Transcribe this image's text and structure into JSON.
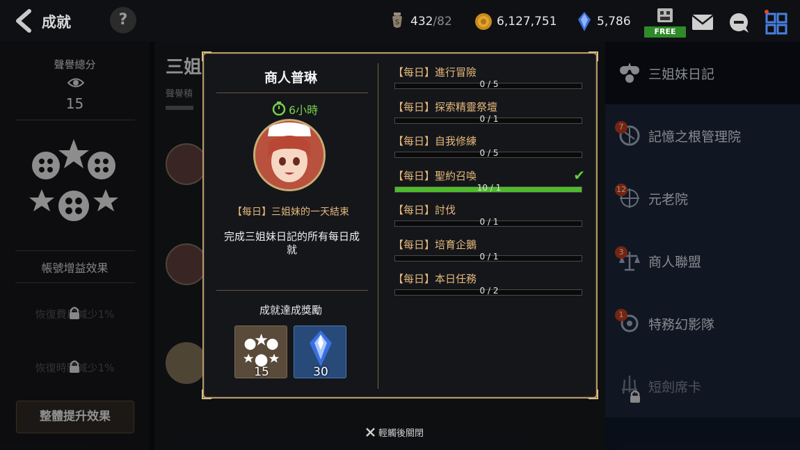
{
  "header": {
    "title": "成就",
    "help_label": "?",
    "stamina": {
      "value": "432",
      "max": "/82"
    },
    "gold": "6,127,751",
    "crystal": "5,786",
    "free_label": "FREE"
  },
  "left_panel": {
    "title": "聲譽總分",
    "score": "15",
    "effect_title": "帳號增益效果",
    "locked_rows": [
      "恢復費用減少1%",
      "恢復時間減少1%"
    ],
    "button_label": "整體提升效果"
  },
  "middle": {
    "title_fragment": "三姐",
    "sub_fragment": "聲譽積"
  },
  "sidebar": {
    "items": [
      {
        "label": "三姐妹日記",
        "badge": ""
      },
      {
        "label": "記憶之根管理院",
        "badge": "7"
      },
      {
        "label": "元老院",
        "badge": "12"
      },
      {
        "label": "商人聯盟",
        "badge": "3"
      },
      {
        "label": "特務幻影隊",
        "badge": "1"
      },
      {
        "label": "短劍席卡",
        "badge": ""
      }
    ]
  },
  "modal": {
    "name": "商人普琳",
    "time": "6小時",
    "quest_title": "【每日】三姐妹的一天結束",
    "description": "完成三姐妹日記的所有每日成就",
    "reward_title": "成就達成獎勵",
    "rewards": [
      {
        "icon": "reputation-emblem-icon",
        "count": "15"
      },
      {
        "icon": "crystal-icon",
        "count": "30"
      }
    ],
    "tasks": [
      {
        "label": "【每日】進行冒險",
        "progress": "0 / 5",
        "fraction": 0,
        "done": false
      },
      {
        "label": "【每日】探索精靈祭壇",
        "progress": "0 / 1",
        "fraction": 0,
        "done": false
      },
      {
        "label": "【每日】自我修練",
        "progress": "0 / 5",
        "fraction": 0,
        "done": false
      },
      {
        "label": "【每日】聖約召喚",
        "progress": "10 / 1",
        "fraction": 1,
        "done": true
      },
      {
        "label": "【每日】討伐",
        "progress": "0 / 1",
        "fraction": 0,
        "done": false
      },
      {
        "label": "【每日】培育企鵝",
        "progress": "0 / 1",
        "fraction": 0,
        "done": false
      },
      {
        "label": "【每日】本日任務",
        "progress": "0 / 2",
        "fraction": 0,
        "done": false
      }
    ],
    "close_hint": "輕觸後關閉"
  },
  "colors": {
    "accent_gold": "#b69a6e",
    "progress_green": "#4fbb2c",
    "quest_text": "#e6b87a",
    "badge_red": "#b23a1c"
  }
}
